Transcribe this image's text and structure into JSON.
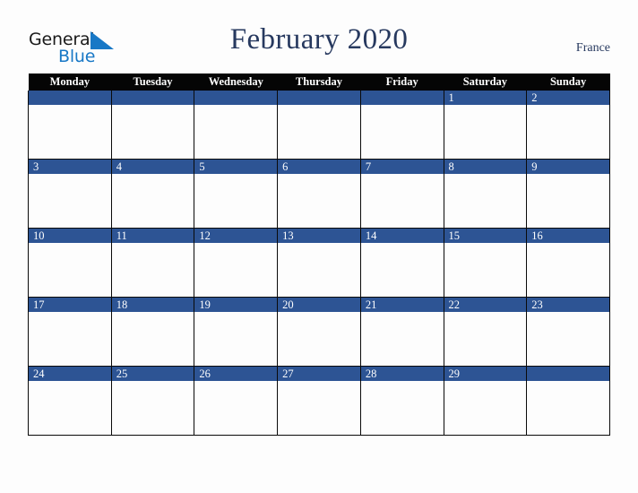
{
  "brand": {
    "name_part1": "General",
    "name_part2": "Blue",
    "triangle_icon": "triangle-icon",
    "accent_blue": "#1878c6"
  },
  "header": {
    "title": "February 2020",
    "country": "France",
    "title_color": "#27395f"
  },
  "calendar": {
    "weekday_headers": [
      "Monday",
      "Tuesday",
      "Wednesday",
      "Thursday",
      "Friday",
      "Saturday",
      "Sunday"
    ],
    "header_bg": "#050505",
    "daynum_bg": "#2d5494",
    "cell_bg": "#fdfdfd",
    "weeks": [
      {
        "days": [
          "",
          "",
          "",
          "",
          "",
          "1",
          "2"
        ]
      },
      {
        "days": [
          "3",
          "4",
          "5",
          "6",
          "7",
          "8",
          "9"
        ]
      },
      {
        "days": [
          "10",
          "11",
          "12",
          "13",
          "14",
          "15",
          "16"
        ]
      },
      {
        "days": [
          "17",
          "18",
          "19",
          "20",
          "21",
          "22",
          "23"
        ]
      },
      {
        "days": [
          "24",
          "25",
          "26",
          "27",
          "28",
          "29",
          ""
        ]
      }
    ]
  }
}
